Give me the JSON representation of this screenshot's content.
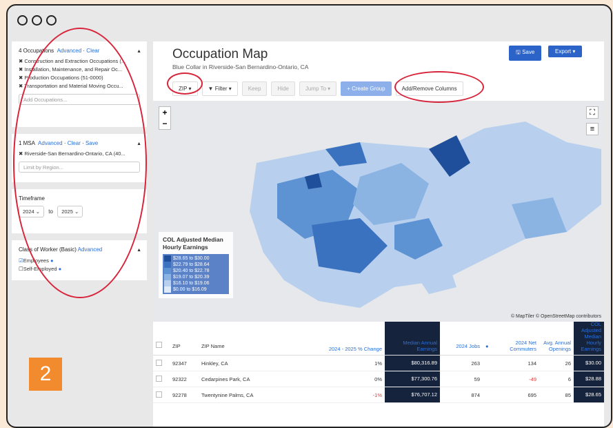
{
  "badge": "2",
  "sidebar": {
    "occupations": {
      "title": "4 Occupations",
      "advanced": "Advanced",
      "clear": "Clear",
      "items": [
        "✖ Construction and Extraction Occupations (...",
        "✖ Installation, Maintenance, and Repair Oc...",
        "✖ Production Occupations (51-0000)",
        "✖ Transportation and Material Moving Occu..."
      ],
      "placeholder": "Add Occupations..."
    },
    "msa": {
      "title": "1 MSA",
      "advanced": "Advanced",
      "clear": "Clear",
      "save": "Save",
      "items": [
        "✖ Riverside-San Bernardino-Ontario, CA (40..."
      ],
      "placeholder": "Limit by Region..."
    },
    "timeframe": {
      "title": "Timeframe",
      "from": "2024 ⌄",
      "to_label": "to",
      "to": "2025 ⌄"
    },
    "worker": {
      "title": "Class of Worker (Basic)",
      "advanced": "Advanced",
      "opt1": "Employees",
      "opt2": "Self-Employed"
    }
  },
  "header": {
    "title": "Occupation Map",
    "subtitle": "Blue Collar in Riverside-San Bernardino-Ontario, CA",
    "save": "Save",
    "export": "Export ▾"
  },
  "toolbar": {
    "zip": "ZIP ▾",
    "filter": "Filter ▾",
    "keep": "Keep",
    "hide": "Hide",
    "jump": "Jump To ▾",
    "group": "+ Create Group",
    "columns": "Add/Remove Columns"
  },
  "map": {
    "credit": "© MapTiler © OpenStreetMap contributors",
    "legend": {
      "title": "COL Adjusted Median Hourly Earnings",
      "rows": [
        "$28.65 to $30.00",
        "$22.79 to $28.64",
        "$20.40 to $22.78",
        "$19.07 to $20.39",
        "$16.10 to $19.06",
        "$0.00 to $16.09"
      ],
      "colors": [
        "#1f4f9a",
        "#3a72c0",
        "#5e93d3",
        "#8cb4e3",
        "#b8d0ee",
        "#dfeaf7"
      ]
    }
  },
  "table": {
    "headers": {
      "zip": "ZIP",
      "name": "ZIP Name",
      "change": "2024 - 2025 % Change",
      "earnings": "Median Annual Earnings",
      "jobs": "2024 Jobs",
      "commuters": "2024 Net Commuters",
      "openings": "Avg. Annual Openings",
      "col": "COL Adjusted Median Hourly Earnings"
    },
    "rows": [
      {
        "zip": "92347",
        "name": "Hinkley, CA",
        "change": "1%",
        "earnings": "$80,316.89",
        "jobs": "263",
        "commuters": "134",
        "openings": "26",
        "col": "$30.00"
      },
      {
        "zip": "92322",
        "name": "Cedarpines Park, CA",
        "change": "0%",
        "earnings": "$77,300.76",
        "jobs": "59",
        "commuters": "-49",
        "openings": "6",
        "col": "$28.88"
      },
      {
        "zip": "92278",
        "name": "Twentynine Palms, CA",
        "change": "-1%",
        "earnings": "$76,707.12",
        "jobs": "874",
        "commuters": "695",
        "openings": "85",
        "col": "$28.65"
      }
    ]
  }
}
